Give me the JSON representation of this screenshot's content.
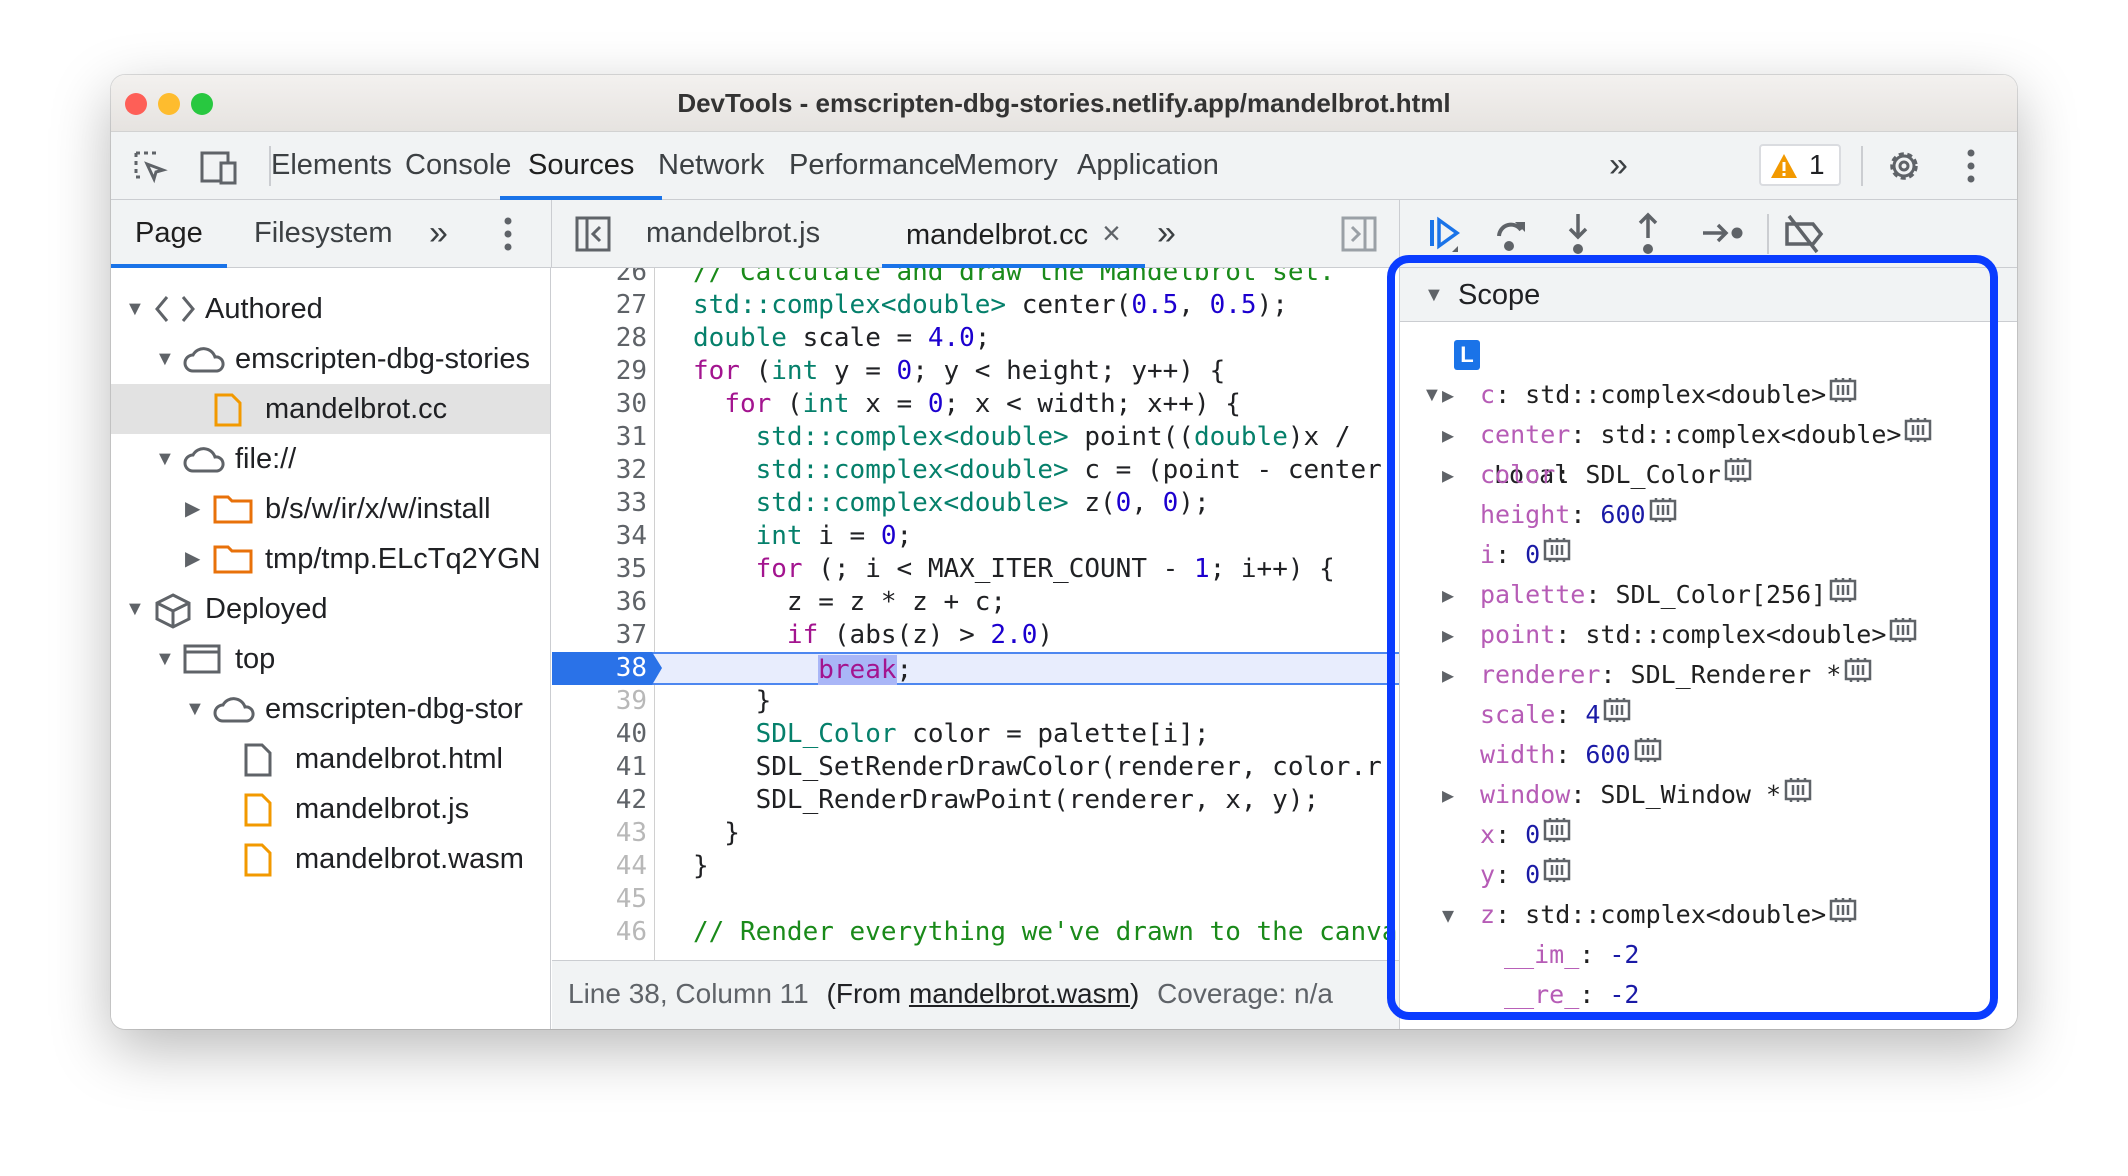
{
  "window": {
    "title": "DevTools - emscripten-dbg-stories.netlify.app/mandelbrot.html"
  },
  "toolbar": {
    "tabs": [
      "Elements",
      "Console",
      "Sources",
      "Network",
      "Performance",
      "Memory",
      "Application"
    ],
    "active_tab": "Sources",
    "more": "»",
    "warning_count": "1"
  },
  "navigator": {
    "tabs": [
      "Page",
      "Filesystem"
    ],
    "active_tab": "Page",
    "tree": [
      {
        "label": "Authored",
        "icon": "code-brackets-icon",
        "indent": 0,
        "expanded": true
      },
      {
        "label": "emscripten-dbg-stories",
        "icon": "cloud-icon",
        "indent": 1,
        "expanded": true
      },
      {
        "label": "mandelbrot.cc",
        "icon": "file-orange-icon",
        "indent": 2,
        "selected": true
      },
      {
        "label": "file://",
        "icon": "cloud-icon",
        "indent": 1,
        "expanded": true
      },
      {
        "label": "b/s/w/ir/x/w/install",
        "icon": "folder-icon",
        "indent": 2,
        "expanded": false
      },
      {
        "label": "tmp/tmp.ELcTq2YGN",
        "icon": "folder-icon",
        "indent": 2,
        "expanded": false
      },
      {
        "label": "Deployed",
        "icon": "cube-icon",
        "indent": 0,
        "expanded": true
      },
      {
        "label": "top",
        "icon": "frame-icon",
        "indent": 1,
        "expanded": true
      },
      {
        "label": "emscripten-dbg-stor",
        "icon": "cloud-icon",
        "indent": 2,
        "expanded": true
      },
      {
        "label": "mandelbrot.html",
        "icon": "file-gray-icon",
        "indent": 3
      },
      {
        "label": "mandelbrot.js",
        "icon": "file-orange-icon",
        "indent": 3
      },
      {
        "label": "mandelbrot.wasm",
        "icon": "file-orange-icon",
        "indent": 3
      }
    ]
  },
  "editor": {
    "tabs": [
      {
        "label": "mandelbrot.js"
      },
      {
        "label": "mandelbrot.cc",
        "active": true,
        "close": "×"
      }
    ],
    "current_line": 38,
    "colors": {
      "comment": "#1a8a1a",
      "type": "#05806b",
      "keyword": "#a3148f",
      "number": "#1c00cf"
    },
    "lines": [
      {
        "n": 26,
        "seg": [
          [
            "c",
            "// Calculate and draw the Mandelbrot set."
          ]
        ]
      },
      {
        "n": 27,
        "seg": [
          [
            "t",
            "std::complex<double>"
          ],
          [
            "p",
            " center("
          ],
          [
            "n",
            "0.5"
          ],
          [
            "p",
            ", "
          ],
          [
            "n",
            "0.5"
          ],
          [
            "p",
            ");"
          ]
        ]
      },
      {
        "n": 28,
        "seg": [
          [
            "t",
            "double"
          ],
          [
            "p",
            " scale = "
          ],
          [
            "n",
            "4.0"
          ],
          [
            "p",
            ";"
          ]
        ]
      },
      {
        "n": 29,
        "seg": [
          [
            "k",
            "for"
          ],
          [
            "p",
            " ("
          ],
          [
            "t",
            "int"
          ],
          [
            "p",
            " y = "
          ],
          [
            "n",
            "0"
          ],
          [
            "p",
            "; y < height; y++) {"
          ]
        ]
      },
      {
        "n": 30,
        "seg": [
          [
            "p",
            "  "
          ],
          [
            "k",
            "for"
          ],
          [
            "p",
            " ("
          ],
          [
            "t",
            "int"
          ],
          [
            "p",
            " x = "
          ],
          [
            "n",
            "0"
          ],
          [
            "p",
            "; x < width; x++) {"
          ]
        ]
      },
      {
        "n": 31,
        "seg": [
          [
            "p",
            "    "
          ],
          [
            "t",
            "std::complex<double>"
          ],
          [
            "p",
            " point(("
          ],
          [
            "t",
            "double"
          ],
          [
            "p",
            ")x / "
          ]
        ]
      },
      {
        "n": 32,
        "seg": [
          [
            "p",
            "    "
          ],
          [
            "t",
            "std::complex<double>"
          ],
          [
            "p",
            " c = (point - center"
          ]
        ]
      },
      {
        "n": 33,
        "seg": [
          [
            "p",
            "    "
          ],
          [
            "t",
            "std::complex<double>"
          ],
          [
            "p",
            " z("
          ],
          [
            "n",
            "0"
          ],
          [
            "p",
            ", "
          ],
          [
            "n",
            "0"
          ],
          [
            "p",
            ");"
          ]
        ]
      },
      {
        "n": 34,
        "seg": [
          [
            "p",
            "    "
          ],
          [
            "t",
            "int"
          ],
          [
            "p",
            " i = "
          ],
          [
            "n",
            "0"
          ],
          [
            "p",
            ";"
          ]
        ]
      },
      {
        "n": 35,
        "seg": [
          [
            "p",
            "    "
          ],
          [
            "k",
            "for"
          ],
          [
            "p",
            " (; i < MAX_ITER_COUNT - "
          ],
          [
            "n",
            "1"
          ],
          [
            "p",
            "; i++) {"
          ]
        ]
      },
      {
        "n": 36,
        "seg": [
          [
            "p",
            "      z = z * z + c;"
          ]
        ]
      },
      {
        "n": 37,
        "seg": [
          [
            "p",
            "      "
          ],
          [
            "k",
            "if"
          ],
          [
            "p",
            " (abs(z) > "
          ],
          [
            "n",
            "2.0"
          ],
          [
            "p",
            ")"
          ]
        ]
      },
      {
        "n": 38,
        "seg": [
          [
            "p",
            "        "
          ],
          [
            "kh",
            "break"
          ],
          [
            "p",
            ";"
          ]
        ]
      },
      {
        "n": 39,
        "dim": true,
        "seg": [
          [
            "p",
            "    }"
          ]
        ]
      },
      {
        "n": 40,
        "seg": [
          [
            "p",
            "    "
          ],
          [
            "t",
            "SDL_Color"
          ],
          [
            "p",
            " color = palette[i];"
          ]
        ]
      },
      {
        "n": 41,
        "seg": [
          [
            "p",
            "    SDL_SetRenderDrawColor(renderer, color.r"
          ]
        ]
      },
      {
        "n": 42,
        "seg": [
          [
            "p",
            "    SDL_RenderDrawPoint(renderer, x, y);"
          ]
        ]
      },
      {
        "n": 43,
        "dim": true,
        "seg": [
          [
            "p",
            "  }"
          ]
        ]
      },
      {
        "n": 44,
        "dim": true,
        "seg": [
          [
            "p",
            "}"
          ]
        ]
      },
      {
        "n": 45,
        "dim": true,
        "seg": []
      },
      {
        "n": 46,
        "dim": true,
        "seg": [
          [
            "c",
            "// Render everything we've drawn to the canvas."
          ]
        ]
      }
    ]
  },
  "status_bar": {
    "position": "Line 38, Column 11",
    "from_prefix": "(From ",
    "from_link": "mandelbrot.wasm",
    "from_suffix": ")",
    "coverage": "Coverage: n/a"
  },
  "debugger": {
    "buttons": [
      "resume-icon",
      "step-over-icon",
      "step-into-icon",
      "step-out-icon",
      "step-icon",
      "deactivate-breakpoints-icon"
    ],
    "scope_title": "Scope",
    "local_badge": "L",
    "local_label": "Local",
    "variables": [
      {
        "name": "c",
        "value": "std::complex<double>",
        "expandable": true
      },
      {
        "name": "center",
        "value": "std::complex<double>",
        "expandable": true
      },
      {
        "name": "color",
        "value": "SDL_Color",
        "expandable": true
      },
      {
        "name": "height",
        "value": "600",
        "number": true
      },
      {
        "name": "i",
        "value": "0",
        "number": true
      },
      {
        "name": "palette",
        "value": "SDL_Color[256]",
        "expandable": true
      },
      {
        "name": "point",
        "value": "std::complex<double>",
        "expandable": true
      },
      {
        "name": "renderer",
        "value": "SDL_Renderer *",
        "expandable": true
      },
      {
        "name": "scale",
        "value": "4",
        "number": true
      },
      {
        "name": "width",
        "value": "600",
        "number": true
      },
      {
        "name": "window",
        "value": "SDL_Window *",
        "expandable": true
      },
      {
        "name": "x",
        "value": "0",
        "number": true
      },
      {
        "name": "y",
        "value": "0",
        "number": true
      },
      {
        "name": "z",
        "value": "std::complex<double>",
        "expandable": true,
        "expanded": true
      },
      {
        "name": "__im_",
        "value": "-2",
        "number": true,
        "child": true
      },
      {
        "name": "__re_",
        "value": "-2",
        "number": true,
        "child": true
      }
    ]
  },
  "highlight_color": "#0a3cff"
}
